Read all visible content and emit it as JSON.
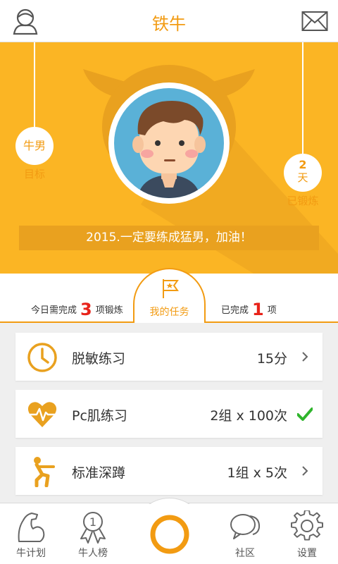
{
  "header": {
    "title": "铁牛"
  },
  "hero": {
    "goal_value": "牛男",
    "goal_label": "目标",
    "trained_days": "2",
    "trained_unit": "天",
    "trained_label": "已锻炼",
    "motto": "2015.一定要练成猛男，加油！"
  },
  "summary": {
    "today_prefix": "今日需完成",
    "today_count": "3",
    "today_suffix": "项锻炼",
    "tab_label": "我的任务",
    "done_prefix": "已完成",
    "done_count": "1",
    "done_suffix": "项"
  },
  "tasks": [
    {
      "name": "脱敏练习",
      "value": "15分",
      "status": "chevron",
      "icon": "clock-icon"
    },
    {
      "name": "Pc肌练习",
      "value": "2组 x 100次",
      "status": "check",
      "icon": "heartbeat-icon"
    },
    {
      "name": "标准深蹲",
      "value": "1组 x 5次",
      "status": "chevron",
      "icon": "squat-icon"
    }
  ],
  "nav": {
    "plan": "牛计划",
    "ranking": "牛人榜",
    "community": "社区",
    "settings": "设置"
  },
  "colors": {
    "accent": "#f29b12",
    "hero_bg": "#fbb524",
    "count_red": "#e8231a",
    "check_green": "#2fb52c"
  }
}
